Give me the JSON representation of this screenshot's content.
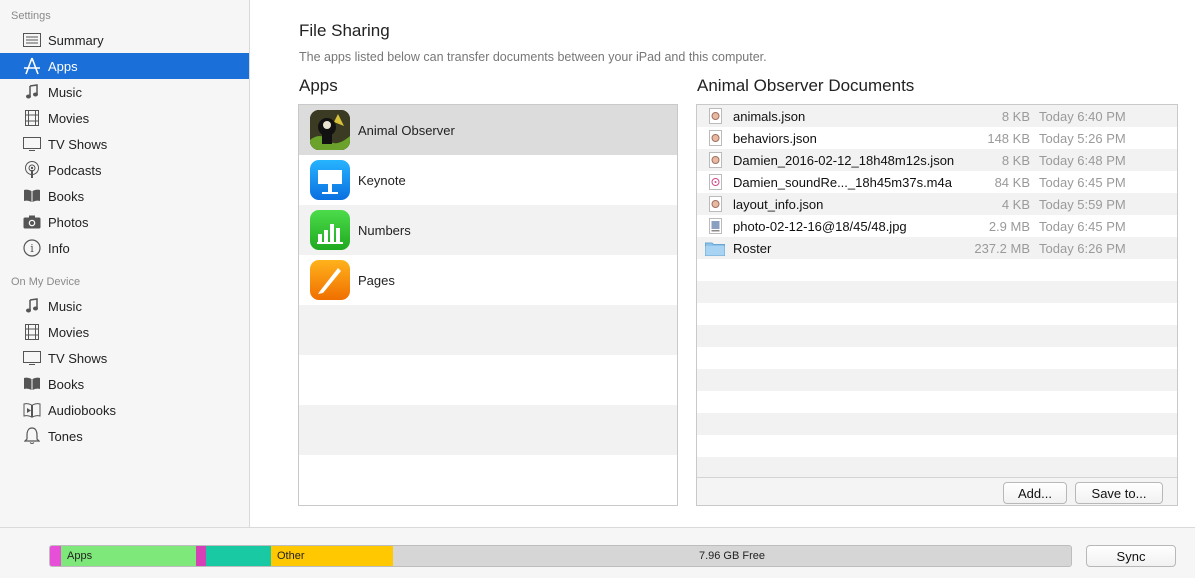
{
  "sidebar": {
    "settings_heading": "Settings",
    "settings_items": [
      {
        "label": "Summary",
        "icon": "summary-icon"
      },
      {
        "label": "Apps",
        "icon": "apps-icon",
        "selected": true
      },
      {
        "label": "Music",
        "icon": "music-icon"
      },
      {
        "label": "Movies",
        "icon": "movies-icon"
      },
      {
        "label": "TV Shows",
        "icon": "tv-icon"
      },
      {
        "label": "Podcasts",
        "icon": "podcasts-icon"
      },
      {
        "label": "Books",
        "icon": "books-icon"
      },
      {
        "label": "Photos",
        "icon": "camera-icon"
      },
      {
        "label": "Info",
        "icon": "info-icon"
      }
    ],
    "device_heading": "On My Device",
    "device_items": [
      {
        "label": "Music",
        "icon": "music-icon"
      },
      {
        "label": "Movies",
        "icon": "movies-icon"
      },
      {
        "label": "TV Shows",
        "icon": "tv-icon"
      },
      {
        "label": "Books",
        "icon": "books-icon"
      },
      {
        "label": "Audiobooks",
        "icon": "audiobooks-icon"
      },
      {
        "label": "Tones",
        "icon": "bell-icon"
      }
    ]
  },
  "main": {
    "title": "File Sharing",
    "subtitle": "The apps listed below can transfer documents between your iPad and this computer.",
    "apps_heading": "Apps",
    "docs_heading": "Animal Observer Documents",
    "apps": [
      {
        "label": "Animal Observer",
        "icon": "animal-observer-icon",
        "selected": true
      },
      {
        "label": "Keynote",
        "icon": "keynote-icon"
      },
      {
        "label": "Numbers",
        "icon": "numbers-icon"
      },
      {
        "label": "Pages",
        "icon": "pages-icon"
      }
    ],
    "documents": [
      {
        "name": "animals.json",
        "size": "8 KB",
        "date": "Today 6:40 PM",
        "icon": "json-file-icon"
      },
      {
        "name": "behaviors.json",
        "size": "148 KB",
        "date": "Today 5:26 PM",
        "icon": "json-file-icon"
      },
      {
        "name": "Damien_2016-02-12_18h48m12s.json",
        "size": "8 KB",
        "date": "Today 6:48 PM",
        "icon": "json-file-icon"
      },
      {
        "name": "Damien_soundRe..._18h45m37s.m4a",
        "size": "84 KB",
        "date": "Today 6:45 PM",
        "icon": "audio-file-icon"
      },
      {
        "name": "layout_info.json",
        "size": "4 KB",
        "date": "Today 5:59 PM",
        "icon": "json-file-icon"
      },
      {
        "name": "photo-02-12-16@18/45/48.jpg",
        "size": "2.9 MB",
        "date": "Today 6:45 PM",
        "icon": "image-file-icon"
      },
      {
        "name": "Roster",
        "size": "237.2 MB",
        "date": "Today 6:26 PM",
        "icon": "folder-icon"
      }
    ],
    "add_button": "Add...",
    "save_button": "Save to..."
  },
  "bottom": {
    "storage": {
      "apps_label": "Apps",
      "other_label": "Other",
      "free_label": "7.96 GB Free",
      "colors": {
        "pink": "#e84fd9",
        "apps": "#7ee87a",
        "magenta": "#d63fb6",
        "teal": "#19c9a3",
        "other": "#ffc800",
        "free": "#d6d6d6"
      }
    },
    "sync_button": "Sync"
  }
}
